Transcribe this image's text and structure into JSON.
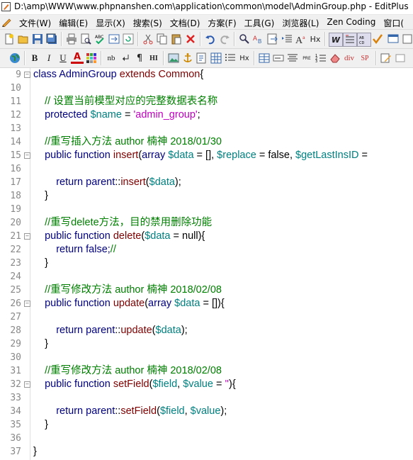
{
  "window": {
    "title": "D:\\amp\\WWW\\www.phpnanshen.com\\application\\common\\model\\AdminGroup.php - EditPlus"
  },
  "menu": [
    {
      "label": "文件(W)"
    },
    {
      "label": "编辑(E)"
    },
    {
      "label": "显示(X)"
    },
    {
      "label": "搜索(S)"
    },
    {
      "label": "文档(D)"
    },
    {
      "label": "方案(F)"
    },
    {
      "label": "工具(G)"
    },
    {
      "label": "浏览器(L)"
    },
    {
      "label": "Zen Coding"
    },
    {
      "label": "窗口("
    }
  ],
  "toolbar2_text": {
    "nb": "nb",
    "pre": "PRE",
    "div": "div",
    "sp": "SP",
    "hx": "Hx",
    "w": "W",
    "b": "B",
    "i": "I",
    "u": "U",
    "a": "A",
    "para": "¶",
    "hi": "HI"
  },
  "lines": [
    {
      "n": "9",
      "fold": "⊟",
      "tokens": [
        {
          "t": "class AdminGroup ",
          "c": "kw"
        },
        {
          "t": "extends Common",
          "c": "op"
        },
        {
          "t": "{",
          "c": "pl"
        }
      ]
    },
    {
      "n": "10",
      "fold": "",
      "tokens": []
    },
    {
      "n": "11",
      "fold": "",
      "tokens": [
        {
          "t": "    // 设置当前模型对应的完整数据表名称",
          "c": "cmt"
        }
      ]
    },
    {
      "n": "12",
      "fold": "",
      "tokens": [
        {
          "t": "    protected ",
          "c": "kw"
        },
        {
          "t": "$name",
          "c": "var"
        },
        {
          "t": " = ",
          "c": "pl"
        },
        {
          "t": "'admin_group'",
          "c": "str"
        },
        {
          "t": ";",
          "c": "pl"
        }
      ]
    },
    {
      "n": "13",
      "fold": "",
      "tokens": []
    },
    {
      "n": "14",
      "fold": "",
      "tokens": [
        {
          "t": "    //重写插入方法 author 楠神 2018/01/30",
          "c": "cmt"
        }
      ]
    },
    {
      "n": "15",
      "fold": "⊟",
      "tokens": [
        {
          "t": "    public function ",
          "c": "kw"
        },
        {
          "t": "insert",
          "c": "op"
        },
        {
          "t": "(",
          "c": "pl"
        },
        {
          "t": "array ",
          "c": "kw"
        },
        {
          "t": "$data",
          "c": "var"
        },
        {
          "t": " = [], ",
          "c": "pl"
        },
        {
          "t": "$replace",
          "c": "var"
        },
        {
          "t": " = false, ",
          "c": "pl"
        },
        {
          "t": "$getLastInsID",
          "c": "var"
        },
        {
          "t": " = ",
          "c": "pl"
        }
      ]
    },
    {
      "n": "16",
      "fold": "",
      "tokens": []
    },
    {
      "n": "17",
      "fold": "",
      "tokens": [
        {
          "t": "        return parent",
          "c": "kw"
        },
        {
          "t": "::",
          "c": "pl"
        },
        {
          "t": "insert",
          "c": "op"
        },
        {
          "t": "(",
          "c": "pl"
        },
        {
          "t": "$data",
          "c": "var"
        },
        {
          "t": ");",
          "c": "pl"
        }
      ]
    },
    {
      "n": "18",
      "fold": "",
      "tokens": [
        {
          "t": "    }",
          "c": "pl"
        }
      ]
    },
    {
      "n": "19",
      "fold": "",
      "tokens": []
    },
    {
      "n": "20",
      "fold": "",
      "tokens": [
        {
          "t": "    //重写delete方法，目的禁用删除功能",
          "c": "cmt"
        }
      ]
    },
    {
      "n": "21",
      "fold": "⊟",
      "tokens": [
        {
          "t": "    public function ",
          "c": "kw"
        },
        {
          "t": "delete",
          "c": "op"
        },
        {
          "t": "(",
          "c": "pl"
        },
        {
          "t": "$data",
          "c": "var"
        },
        {
          "t": " = null){",
          "c": "pl"
        }
      ]
    },
    {
      "n": "22",
      "fold": "",
      "tokens": [
        {
          "t": "        return false;",
          "c": "kw"
        },
        {
          "t": "//",
          "c": "cmt"
        }
      ]
    },
    {
      "n": "23",
      "fold": "",
      "tokens": [
        {
          "t": "    }",
          "c": "pl"
        }
      ]
    },
    {
      "n": "24",
      "fold": "",
      "tokens": []
    },
    {
      "n": "25",
      "fold": "",
      "tokens": [
        {
          "t": "    //重写修改方法 author 楠神 2018/02/08",
          "c": "cmt"
        }
      ]
    },
    {
      "n": "26",
      "fold": "⊟",
      "tokens": [
        {
          "t": "    public function ",
          "c": "kw"
        },
        {
          "t": "update",
          "c": "op"
        },
        {
          "t": "(",
          "c": "pl"
        },
        {
          "t": "array ",
          "c": "kw"
        },
        {
          "t": "$data",
          "c": "var"
        },
        {
          "t": " = []){",
          "c": "pl"
        }
      ]
    },
    {
      "n": "27",
      "fold": "",
      "tokens": []
    },
    {
      "n": "28",
      "fold": "",
      "tokens": [
        {
          "t": "        return parent",
          "c": "kw"
        },
        {
          "t": "::",
          "c": "pl"
        },
        {
          "t": "update",
          "c": "op"
        },
        {
          "t": "(",
          "c": "pl"
        },
        {
          "t": "$data",
          "c": "var"
        },
        {
          "t": ");",
          "c": "pl"
        }
      ]
    },
    {
      "n": "29",
      "fold": "",
      "tokens": [
        {
          "t": "    }",
          "c": "pl"
        }
      ]
    },
    {
      "n": "30",
      "fold": "",
      "tokens": []
    },
    {
      "n": "31",
      "fold": "",
      "tokens": [
        {
          "t": "    //重写修改方法 author 楠神 2018/02/08",
          "c": "cmt"
        }
      ]
    },
    {
      "n": "32",
      "fold": "⊟",
      "tokens": [
        {
          "t": "    public function ",
          "c": "kw"
        },
        {
          "t": "setField",
          "c": "op"
        },
        {
          "t": "(",
          "c": "pl"
        },
        {
          "t": "$field",
          "c": "var"
        },
        {
          "t": ", ",
          "c": "pl"
        },
        {
          "t": "$value",
          "c": "var"
        },
        {
          "t": " = ",
          "c": "pl"
        },
        {
          "t": "''",
          "c": "str"
        },
        {
          "t": "){",
          "c": "pl"
        }
      ]
    },
    {
      "n": "33",
      "fold": "",
      "tokens": []
    },
    {
      "n": "34",
      "fold": "",
      "tokens": [
        {
          "t": "        return parent",
          "c": "kw"
        },
        {
          "t": "::",
          "c": "pl"
        },
        {
          "t": "setField",
          "c": "op"
        },
        {
          "t": "(",
          "c": "pl"
        },
        {
          "t": "$field",
          "c": "var"
        },
        {
          "t": ", ",
          "c": "pl"
        },
        {
          "t": "$value",
          "c": "var"
        },
        {
          "t": ");",
          "c": "pl"
        }
      ]
    },
    {
      "n": "35",
      "fold": "",
      "tokens": [
        {
          "t": "    }",
          "c": "pl"
        }
      ]
    },
    {
      "n": "36",
      "fold": "",
      "tokens": []
    },
    {
      "n": "37",
      "fold": "",
      "tokens": [
        {
          "t": "}",
          "c": "pl"
        }
      ]
    }
  ]
}
